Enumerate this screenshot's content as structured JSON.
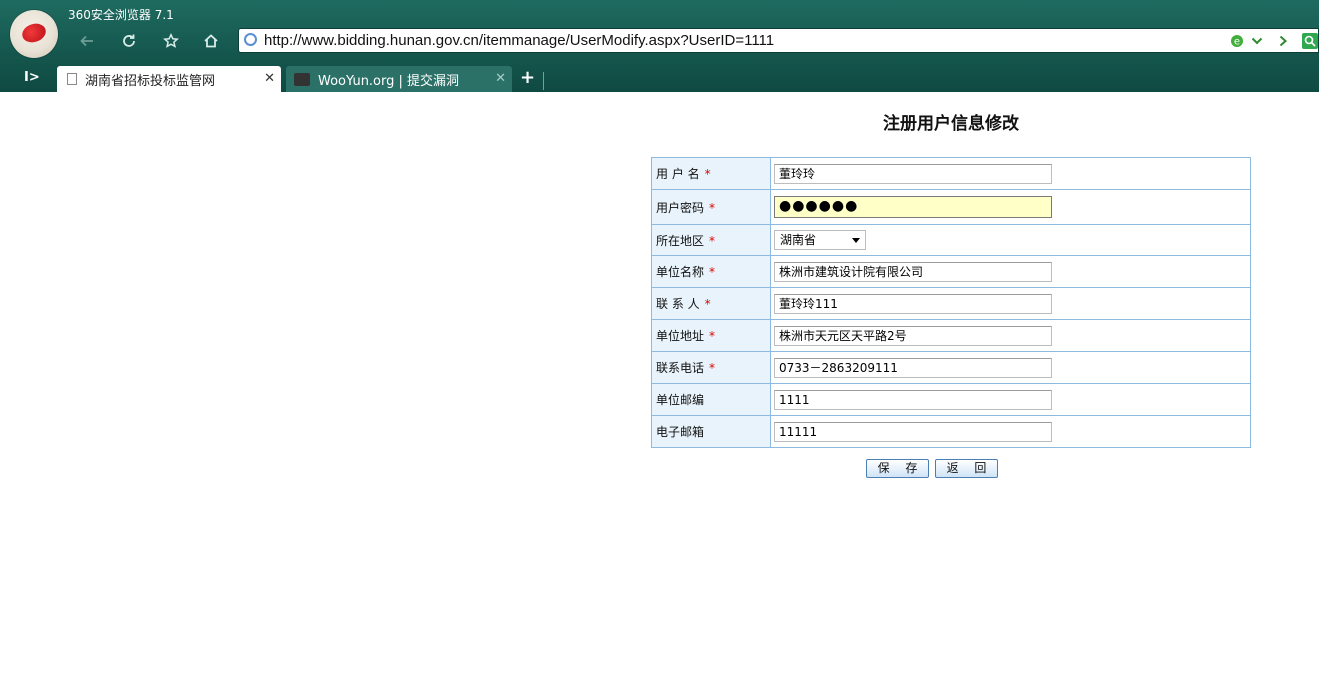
{
  "app": {
    "title": "360安全浏览器 7.1"
  },
  "address_bar": {
    "url": "http://www.bidding.hunan.gov.cn/itemmanage/UserModify.aspx?UserID=1111"
  },
  "tabs": [
    {
      "label": "湖南省招标投标监管网",
      "active": true
    },
    {
      "label": "WooYun.org | 提交漏洞",
      "active": false
    }
  ],
  "page": {
    "title": "注册用户信息修改"
  },
  "form": {
    "rows": [
      {
        "label": "用 户 名",
        "required": true,
        "type": "text",
        "value": "董玲玲"
      },
      {
        "label": "用户密码",
        "required": true,
        "type": "password",
        "value": "●●●●●●"
      },
      {
        "label": "所在地区",
        "required": true,
        "type": "select",
        "value": "湖南省"
      },
      {
        "label": "单位名称",
        "required": true,
        "type": "text",
        "value": "株洲市建筑设计院有限公司"
      },
      {
        "label": "联 系 人",
        "required": true,
        "type": "text",
        "value": "董玲玲111"
      },
      {
        "label": "单位地址",
        "required": true,
        "type": "text",
        "value": "株洲市天元区天平路2号"
      },
      {
        "label": "联系电话",
        "required": true,
        "type": "text",
        "value": "0733－2863209111"
      },
      {
        "label": "单位邮编",
        "required": false,
        "type": "text",
        "value": "1111"
      },
      {
        "label": "电子邮箱",
        "required": false,
        "type": "text",
        "value": "11111"
      }
    ],
    "required_mark": "*",
    "save_label": "保 存",
    "back_label": "返 回"
  },
  "colors": {
    "chrome": "#14564d",
    "label_bg": "#e8f3fb",
    "border": "#8fbadf",
    "required": "#e20000"
  }
}
